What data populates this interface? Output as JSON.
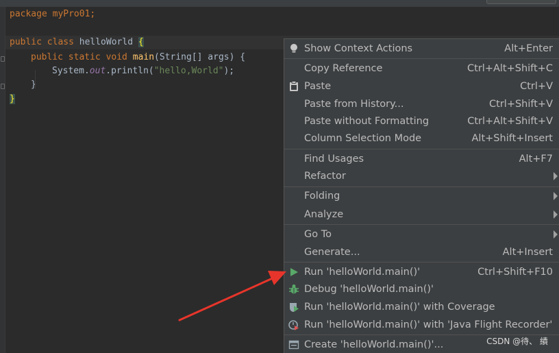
{
  "editor": {
    "line1": "package myPro01;",
    "line2_kw": "public class",
    "line2_name": "helloWorld",
    "line2_brace": "{",
    "line3_kw": "public static void",
    "line3_fn": "main",
    "line3_params": "(String[] args) {",
    "line4_pre": "System.",
    "line4_field": "out",
    "line4_call": ".println(",
    "line4_str": "\"hello,World\"",
    "line4_end": ");",
    "line5": "}",
    "line6": "}"
  },
  "menu": {
    "items": [
      {
        "label": "Show Context Actions",
        "shortcut": "Alt+Enter",
        "icon": "bulb-icon"
      },
      {
        "label": "Copy Reference",
        "shortcut": "Ctrl+Alt+Shift+C"
      },
      {
        "label": "Paste",
        "shortcut": "Ctrl+V",
        "icon": "clipboard-icon"
      },
      {
        "label": "Paste from History...",
        "shortcut": "Ctrl+Shift+V"
      },
      {
        "label": "Paste without Formatting",
        "shortcut": "Ctrl+Alt+Shift+V"
      },
      {
        "label": "Column Selection Mode",
        "shortcut": "Alt+Shift+Insert"
      },
      {
        "label": "Find Usages",
        "shortcut": "Alt+F7"
      },
      {
        "label": "Refactor",
        "shortcut": ""
      },
      {
        "label": "Folding",
        "shortcut": ""
      },
      {
        "label": "Analyze",
        "shortcut": ""
      },
      {
        "label": "Go To",
        "shortcut": ""
      },
      {
        "label": "Generate...",
        "shortcut": "Alt+Insert"
      },
      {
        "label": "Run 'helloWorld.main()'",
        "shortcut": "Ctrl+Shift+F10",
        "icon": "run-icon"
      },
      {
        "label": "Debug 'helloWorld.main()'",
        "shortcut": "",
        "icon": "debug-icon"
      },
      {
        "label": "Run 'helloWorld.main()' with Coverage",
        "shortcut": "",
        "icon": "coverage-icon"
      },
      {
        "label": "Run 'helloWorld.main()' with 'Java Flight Recorder'",
        "shortcut": "",
        "icon": "flight-recorder-icon"
      },
      {
        "label": "Create 'helloWorld.main()'...",
        "shortcut": "",
        "icon": "create-config-icon"
      }
    ]
  },
  "watermark": "CSDN @待、 績",
  "colors": {
    "arrow": "#e8352b",
    "run_green": "#59a869",
    "menu_bg": "#3c3f41"
  }
}
